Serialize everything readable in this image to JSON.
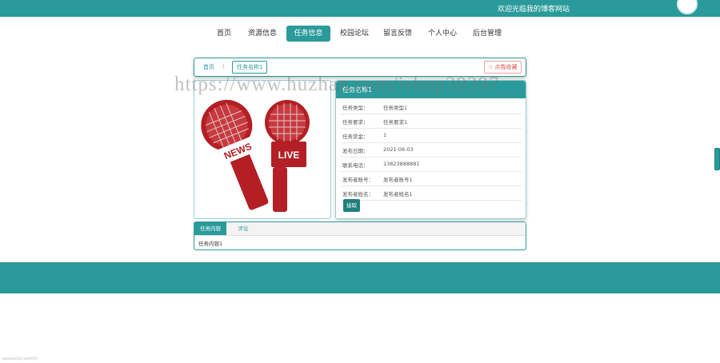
{
  "header": {
    "welcome": "欢迎光临我的博客网站"
  },
  "nav": [
    {
      "label": "首页"
    },
    {
      "label": "资源信息"
    },
    {
      "label": "任务信息"
    },
    {
      "label": "校园论坛"
    },
    {
      "label": "留言反馈"
    },
    {
      "label": "个人中心"
    },
    {
      "label": "后台管理"
    }
  ],
  "breadcrumb": {
    "home": "首页",
    "separator": "/",
    "current": "任务名称1"
  },
  "favorite_label": "☆ 点我收藏",
  "image": {
    "tag_news": "NEWS",
    "tag_live": "LIVE"
  },
  "detail": {
    "header_title": "任务名称1",
    "rows": [
      {
        "key": "任务类型：",
        "value": "任务类型1"
      },
      {
        "key": "任务要求：",
        "value": "任务要求1"
      },
      {
        "key": "任务赏金：",
        "value": "1"
      },
      {
        "key": "发布日期：",
        "value": "2021-06-03"
      },
      {
        "key": "联系电话：",
        "value": "13823888881"
      },
      {
        "key": "发布者账号：",
        "value": "发布者账号1"
      },
      {
        "key": "发布者姓名：",
        "value": "发布者姓名1"
      }
    ],
    "accept_button": "接取"
  },
  "tabs": [
    {
      "label": "任务内容"
    },
    {
      "label": "评论"
    }
  ],
  "tab_content": "任务内容1",
  "watermark": "https://www.huzhan.com/ishop39397",
  "status_bar": "javascript:void(0)",
  "colors": {
    "primary": "#2a9a9a",
    "accent_red": "#d9534f"
  }
}
